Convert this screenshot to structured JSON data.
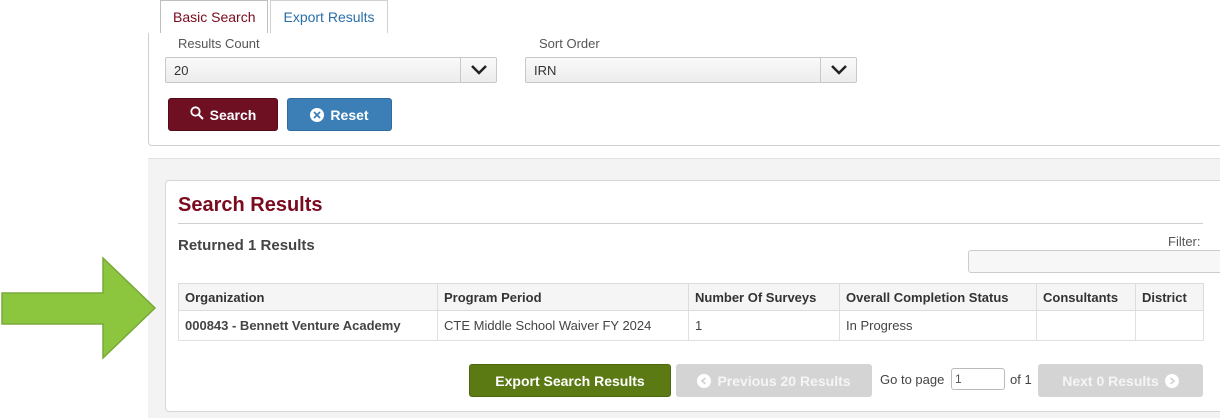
{
  "tabs": [
    {
      "label": "Basic Search"
    },
    {
      "label": "Export Results"
    }
  ],
  "search": {
    "results_count_label": "Results Count",
    "results_count_value": "20",
    "sort_order_label": "Sort Order",
    "sort_order_value": "IRN",
    "search_button": "Search",
    "reset_button": "Reset"
  },
  "results": {
    "title": "Search Results",
    "count_text": "Returned 1 Results",
    "filter_label": "Filter:",
    "columns": [
      "Organization",
      "Program Period",
      "Number Of Surveys",
      "Overall Completion Status",
      "Consultants",
      "District"
    ],
    "rows": [
      {
        "organization": "000843 - Bennett Venture Academy",
        "program_period": "CTE Middle School Waiver FY 2024",
        "surveys": "1",
        "status": "In Progress",
        "consultants": "",
        "district": ""
      }
    ]
  },
  "pager": {
    "export_button": "Export Search Results",
    "previous_button": "Previous 20 Results",
    "goto_label": "Go to page",
    "page_value": "1",
    "of_label": "of 1",
    "next_button": "Next 0 Results"
  },
  "colors": {
    "accent": "#7a0a1e",
    "link": "#2a6ea8",
    "export": "#5c7a14",
    "arrow": "#8cc63f"
  }
}
